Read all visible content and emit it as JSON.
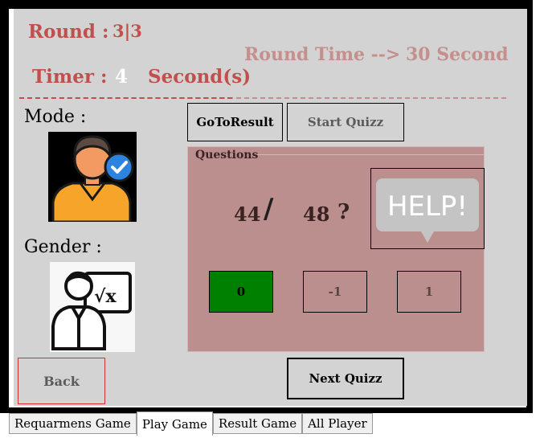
{
  "header": {
    "round_label": "Round :",
    "round_value": "3|3",
    "round_time_label": "Round Time -->",
    "round_time_value": "30 Second",
    "timer_label": "Timer :",
    "timer_value": "4",
    "timer_unit": "Second(s)"
  },
  "profile": {
    "mode_label": "Mode :",
    "gender_label": "Gender :"
  },
  "toolbar": {
    "goto_result": "GoToResult",
    "start_quiz": "Start Quizz"
  },
  "questions": {
    "legend": "Questions",
    "operand1": "44",
    "operator": "/",
    "operand2": "48",
    "mark": "?",
    "help_text": "HELP!",
    "answers": [
      "0",
      "-1",
      "1"
    ],
    "selected_answer_color": "#008000"
  },
  "footer": {
    "back": "Back",
    "next_quiz": "Next Quizz"
  },
  "tabs": [
    "Requarmens Game",
    "Play Game",
    "Result Game",
    "All Player"
  ],
  "active_tab": "Play Game",
  "colors": {
    "accent_red": "#c0504d",
    "muted_red": "#c48f8d",
    "panel_gray": "#d3d3d3",
    "questions_bg": "#bc8f8f"
  },
  "icons": {
    "mode": "user-check-icon",
    "gender": "teacher-board-icon",
    "help": "help-speech-bubble-icon"
  }
}
